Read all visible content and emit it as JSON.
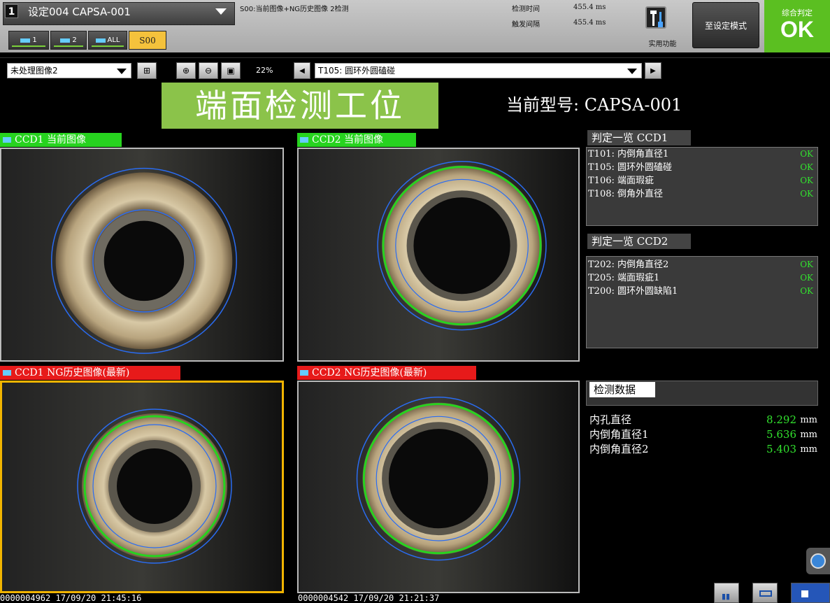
{
  "header": {
    "setting_num": "1",
    "setting_label": "设定004 CAPSA-001",
    "mode_text": "S00:当前图像+NG历史图像 2检测",
    "detect_time_label": "检测时间",
    "detect_time_value": "455.4 ms",
    "trigger_interval_label": "触发间隔",
    "trigger_interval_value": "455.4 ms",
    "utility_label": "实用功能",
    "set_mode_label": "至设定模式",
    "judge_label": "综合判定",
    "judge_value": "OK",
    "tabs": [
      "1",
      "2",
      "ALL",
      "S00"
    ]
  },
  "toolbar": {
    "image_select": "未处理图像2",
    "zoom": "22%",
    "tool_select": "T105: 圆环外圆磕碰"
  },
  "banner": {
    "station": "端面检测工位",
    "model": "当前型号: CAPSA-001"
  },
  "panels": {
    "ccd1_current": "CCD1 当前图像",
    "ccd2_current": "CCD2 当前图像",
    "ccd1_ng": "CCD1 NG历史图像(最新)",
    "ccd2_ng": "CCD2 NG历史图像(最新)",
    "ccd1_ng_timestamp": "0000004962 17/09/20 21:45:16",
    "ccd2_ng_timestamp": "0000004542 17/09/20 21:21:37"
  },
  "judge_ccd1": {
    "title": "判定一览 CCD1",
    "items": [
      {
        "name": "T101: 内倒角直径1",
        "result": "OK"
      },
      {
        "name": "T105: 圆环外圆磕碰",
        "result": "OK"
      },
      {
        "name": "T106: 端面瑕疵",
        "result": "OK"
      },
      {
        "name": "T108: 倒角外直径",
        "result": "OK"
      }
    ]
  },
  "judge_ccd2": {
    "title": "判定一览 CCD2",
    "items": [
      {
        "name": "T202: 内倒角直径2",
        "result": "OK"
      },
      {
        "name": "T205: 端面瑕疵1",
        "result": "OK"
      },
      {
        "name": "T200: 圆环外圆缺陷1",
        "result": "OK"
      }
    ]
  },
  "measurements": {
    "title": "检测数据",
    "items": [
      {
        "name": "内孔直径",
        "value": "8.292",
        "unit": "mm"
      },
      {
        "name": "内倒角直径1",
        "value": "5.636",
        "unit": "mm"
      },
      {
        "name": "内倒角直径2",
        "value": "5.403",
        "unit": "mm"
      }
    ]
  },
  "colors": {
    "ok_green": "#32e22e",
    "title_green": "#27d31f",
    "ng_red": "#e71a1a",
    "judge_green": "#5bbf21",
    "selected_border": "#f1b400"
  }
}
